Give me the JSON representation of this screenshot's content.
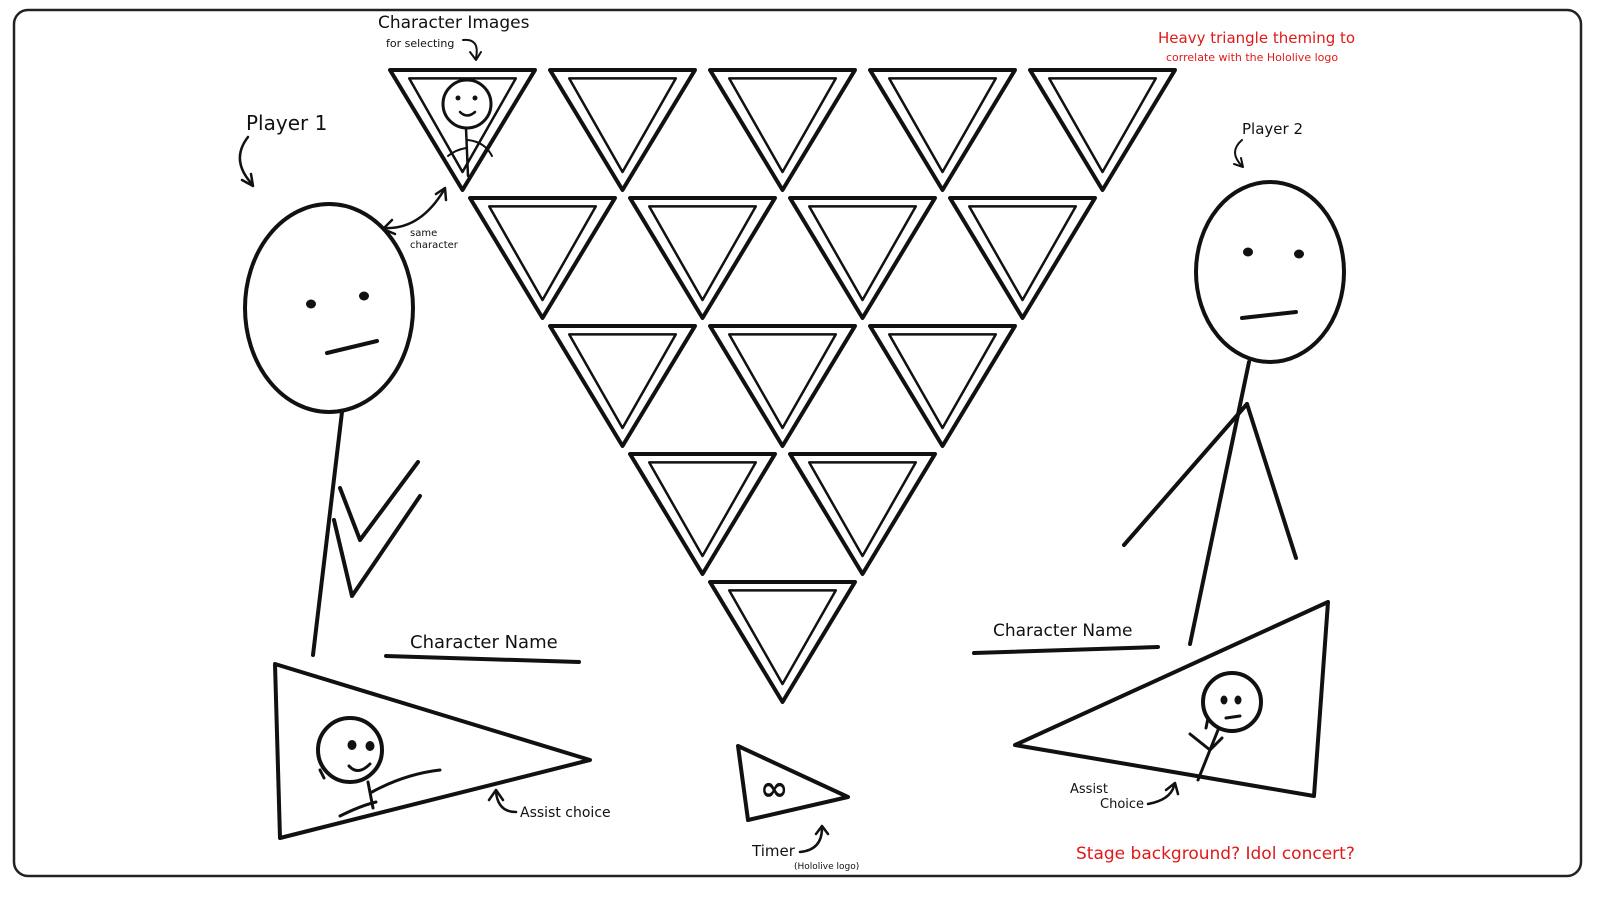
{
  "annotations": {
    "character_images": "Character Images",
    "for_selecting": "for selecting",
    "player1": "Player 1",
    "player2": "Player 2",
    "same_character": "same",
    "same_character_2": "character",
    "character_name_left": "Character Name",
    "character_name_right": "Character Name",
    "assist_choice_left": "Assist choice",
    "assist_right_1": "Assist",
    "assist_right_2": "Choice",
    "timer": "Timer",
    "hololive_logo": "(Hololive logo)",
    "timer_symbol": "∞",
    "theme_note_1": "Heavy triangle theming to",
    "theme_note_2": "correlate with the Hololive logo",
    "stage_note": "Stage background? Idol concert?"
  },
  "colors": {
    "ink": "#111111",
    "note_red": "#e01919",
    "frame": "#222222"
  },
  "character_grid": {
    "row_counts": [
      5,
      4,
      3,
      2,
      1
    ]
  }
}
